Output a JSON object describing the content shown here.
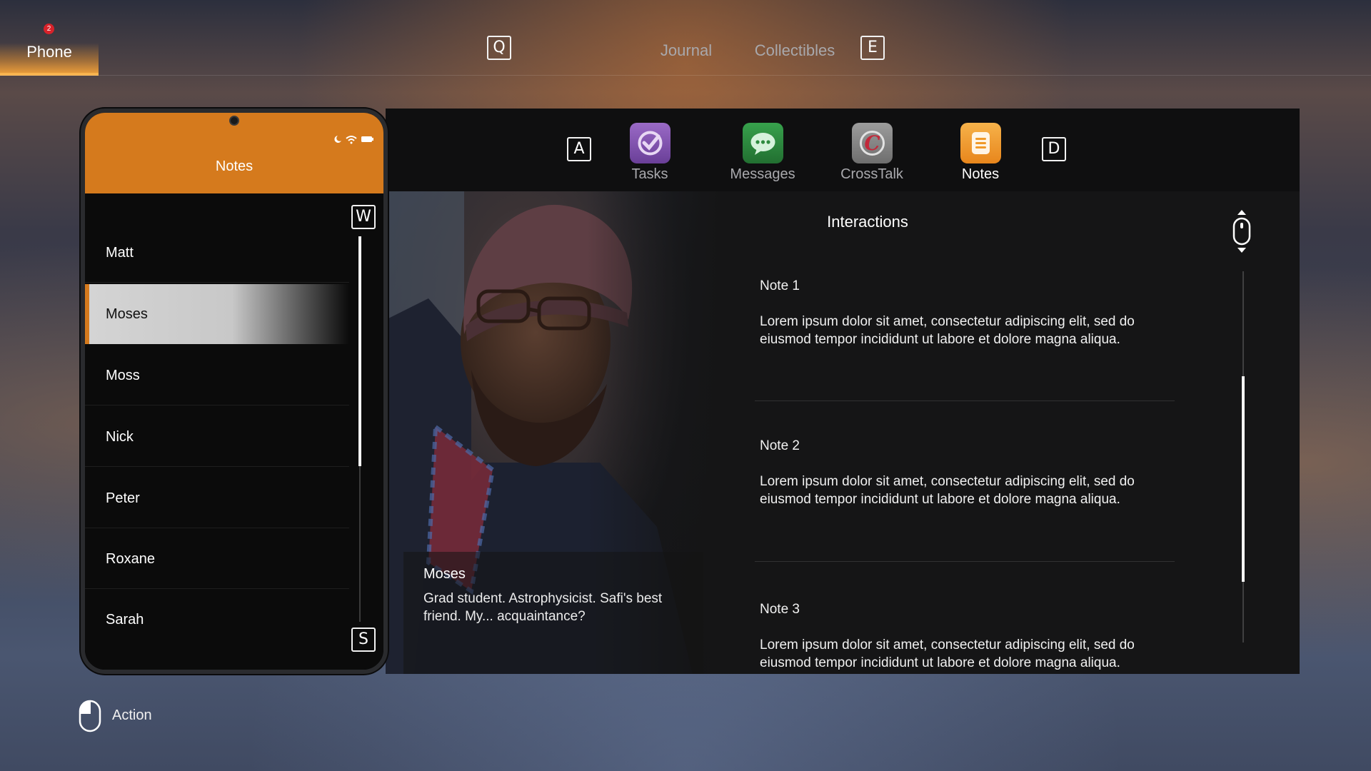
{
  "top_nav": {
    "left_key": "Q",
    "right_key": "E",
    "tabs": [
      {
        "label": "Phone",
        "badge": "2",
        "active": true
      },
      {
        "label": "Journal"
      },
      {
        "label": "Collectibles"
      }
    ]
  },
  "phone": {
    "title": "Notes",
    "up_key": "W",
    "down_key": "S",
    "contacts": [
      "Matt",
      "Moses",
      "Moss",
      "Nick",
      "Peter",
      "Roxane",
      "Sarah"
    ],
    "selected": "Moses"
  },
  "apps": {
    "left_key": "A",
    "right_key": "D",
    "items": [
      {
        "label": "Tasks",
        "icon": "tasks-icon",
        "color": "#7b4fa6"
      },
      {
        "label": "Messages",
        "icon": "messages-icon",
        "color": "#2e8a3f"
      },
      {
        "label": "CrossTalk",
        "icon": "crosstalk-icon",
        "color": "#c2283a"
      },
      {
        "label": "Notes",
        "icon": "notes-icon",
        "color": "#f09a2a",
        "active": true
      }
    ]
  },
  "profile": {
    "name": "Moses",
    "description": "Grad student. Astrophysicist. Safi's best friend. My... acquaintance?"
  },
  "interactions": {
    "heading": "Interactions",
    "notes": [
      {
        "title": "Note 1",
        "body": "Lorem ipsum dolor sit amet, consectetur adipiscing elit, sed do eiusmod tempor incididunt ut labore et dolore magna aliqua."
      },
      {
        "title": "Note 2",
        "body": "Lorem ipsum dolor sit amet, consectetur adipiscing elit, sed do eiusmod tempor incididunt ut labore et dolore magna aliqua."
      },
      {
        "title": "Note 3",
        "body": "Lorem ipsum dolor sit amet, consectetur adipiscing elit, sed do eiusmod tempor incididunt ut labore et dolore magna aliqua."
      }
    ]
  },
  "footer": {
    "action_label": "Action"
  },
  "colors": {
    "accent": "#d57a1d",
    "badge": "#d8222a"
  }
}
